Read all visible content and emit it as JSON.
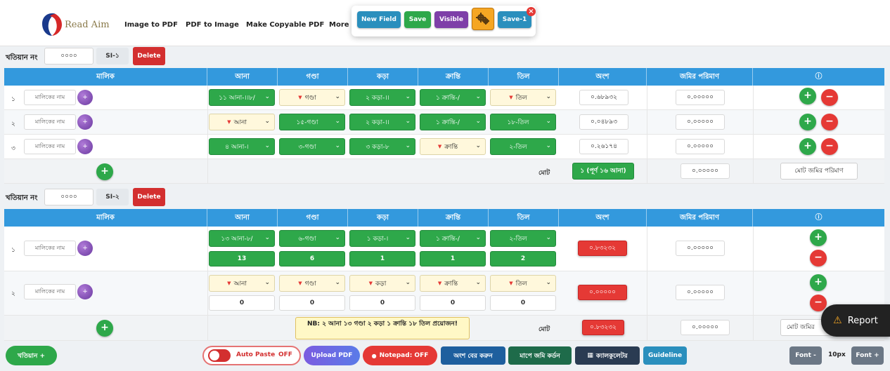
{
  "nav": {
    "brand": "Read Aim",
    "links": [
      "Image to PDF",
      "PDF to Image",
      "Make Copyable PDF",
      "More To"
    ]
  },
  "toolbar": {
    "new_field": "New Field",
    "save": "Save",
    "visible": "Visible",
    "save1": "Save-1",
    "close": "×",
    "gear_icon": "gear-icon",
    "colors": {
      "new_field": "#2a8fbd",
      "save": "#2ea84a",
      "visible": "#7e3fa8",
      "gear": "#f5a623",
      "save1": "#2a8fbd"
    }
  },
  "headers": {
    "owner": "মালিক",
    "ana": "আনা",
    "gonda": "গণ্ডা",
    "kora": "কড়া",
    "kranti": "ক্রান্তি",
    "til": "তিল",
    "ansh": "অংশ",
    "land": "জমির পরিমাণ",
    "info": "ⓘ"
  },
  "common": {
    "khatian_label": "খতিয়ান নং",
    "name_placeholder": "মালিকের নাম",
    "total_label": "মোট",
    "total_land_btn": "মোট জমির পরিমাণ",
    "delete": "Delete"
  },
  "section1": {
    "khatian_no": "০০০০",
    "si": "SI-১",
    "rows": [
      {
        "num": "১",
        "ana": "১১ আনা-।।৮/",
        "gonda": "গণ্ডা",
        "kora": "২ কড়া-।।",
        "kranti": "১ ক্রান্তি-/",
        "til": "তিল",
        "ansh": "০.৬৮৯৩২",
        "land": "০.০০০০০"
      },
      {
        "num": "২",
        "ana": "আনা",
        "gonda": "১৫-গণ্ডা",
        "kora": "২ কড়া-।।",
        "kranti": "১ ক্রান্তি-/",
        "til": "১৮-তিল",
        "ansh": "০.০৪৮৯৩",
        "land": "০.০০০০০"
      },
      {
        "num": "৩",
        "ana": "৪ আনা-।",
        "gonda": "৩-গণ্ডা",
        "kora": "৩ কড়া-৮",
        "kranti": "ক্রান্তি",
        "til": "২-তিল",
        "ansh": "০.২৬১৭৪",
        "land": "০.০০০০০"
      }
    ],
    "total_ansh": "১ (পূর্ণ ১৬ আনা)",
    "total_land": "০.০০০০০"
  },
  "section2": {
    "khatian_no": "০০০০",
    "si": "SI-২",
    "rows": [
      {
        "num": "১",
        "ana": "১৩ আনা-৮/",
        "gonda": "৬-গণ্ডা",
        "kora": "১ কড়া-।",
        "kranti": "১ ক্রান্তি-/",
        "til": "২-তিল",
        "v_ana": "13",
        "v_gonda": "6",
        "v_kora": "1",
        "v_kranti": "1",
        "v_til": "2",
        "ansh": "০.৮৩২৩২",
        "land": "০.০০০০০"
      },
      {
        "num": "২",
        "ana": "আনা",
        "gonda": "গণ্ডা",
        "kora": "কড়া",
        "kranti": "ক্রান্তি",
        "til": "তিল",
        "v_ana": "0",
        "v_gonda": "0",
        "v_kora": "0",
        "v_kranti": "0",
        "v_til": "0",
        "ansh": "০.০০০০০",
        "land": "০.০০০০০"
      }
    ],
    "note": "NB: ২ আনা ১৩ গণ্ডা ২ কড়া ১ ক্রান্তি ১৮ তিল প্রয়োজন!",
    "total_ansh": "০.৮৩২৩২",
    "total_land": "০.০০০০০",
    "total_land_btn": "মোট জমির"
  },
  "bottom": {
    "khatian_add": "খতিয়ান +",
    "auto_paste": "Auto Paste",
    "auto_paste_state": "OFF",
    "upload_pdf": "Upload PDF",
    "notepad": "Notepad: OFF",
    "calc_share": "অংশ বের করুন",
    "calc_land": "মাপে জমি কর্ডন",
    "calculator": "ক্যালকুলেটর",
    "calculator_icon": "calculator-icon",
    "guideline": "Guideline",
    "font_minus": "Font -",
    "font_size": "10px",
    "font_plus": "Font +",
    "report": "Report",
    "report_icon": "warning-icon"
  }
}
